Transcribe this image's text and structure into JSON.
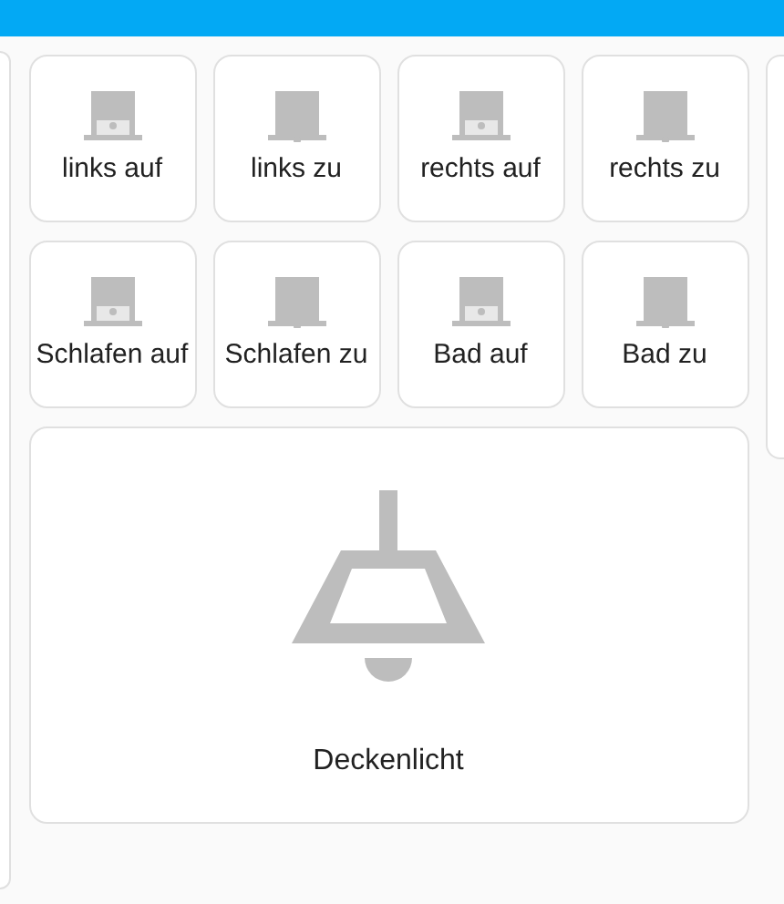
{
  "buttons": [
    {
      "label": "links auf",
      "kind": "open"
    },
    {
      "label": "links zu",
      "kind": "closed"
    },
    {
      "label": "rechts auf",
      "kind": "open"
    },
    {
      "label": "rechts zu",
      "kind": "closed"
    },
    {
      "label": "Schlafen auf",
      "kind": "open"
    },
    {
      "label": "Schlafen zu",
      "kind": "closed"
    },
    {
      "label": "Bad auf",
      "kind": "open"
    },
    {
      "label": "Bad zu",
      "kind": "closed"
    }
  ],
  "light": {
    "label": "Deckenlicht"
  }
}
